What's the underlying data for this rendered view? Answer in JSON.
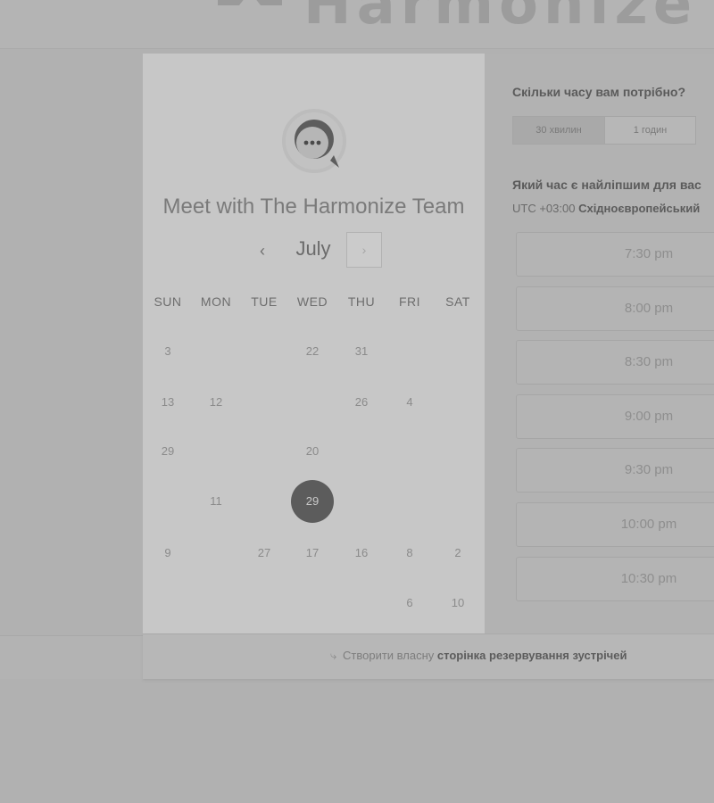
{
  "header": {
    "brand": "Harmonize"
  },
  "calendar": {
    "title": "Meet with The Harmonize Team",
    "month": "July",
    "prev_label": "‹",
    "next_label": "›",
    "weekdays": [
      "SUN",
      "MON",
      "TUE",
      "WED",
      "THU",
      "FRI",
      "SAT"
    ],
    "days": [
      {
        "label": "3",
        "col": 0,
        "row": 0
      },
      {
        "label": "22",
        "col": 3,
        "row": 0
      },
      {
        "label": "31",
        "col": 4,
        "row": 0
      },
      {
        "label": "13",
        "col": 0,
        "row": 1
      },
      {
        "label": "12",
        "col": 1,
        "row": 1
      },
      {
        "label": "26",
        "col": 4,
        "row": 1
      },
      {
        "label": "4",
        "col": 5,
        "row": 1
      },
      {
        "label": "29",
        "col": 0,
        "row": 2
      },
      {
        "label": "20",
        "col": 3,
        "row": 2
      },
      {
        "label": "11",
        "col": 1,
        "row": 3
      },
      {
        "label": "29",
        "col": 3,
        "row": 3,
        "selected": true
      },
      {
        "label": "9",
        "col": 0,
        "row": 4
      },
      {
        "label": "27",
        "col": 2,
        "row": 4
      },
      {
        "label": "17",
        "col": 3,
        "row": 4
      },
      {
        "label": "16",
        "col": 4,
        "row": 4
      },
      {
        "label": "8",
        "col": 5,
        "row": 4
      },
      {
        "label": "2",
        "col": 6,
        "row": 4
      },
      {
        "label": "6",
        "col": 5,
        "row": 5
      },
      {
        "label": "10",
        "col": 6,
        "row": 5
      }
    ]
  },
  "booking": {
    "duration_question": "Скільки часу вам потрібно?",
    "durations": [
      "30 хвилин",
      "1 годин"
    ],
    "time_question": "Який час є найліпшим для вас",
    "tz_offset": "UTC +03:00",
    "tz_name": "Східноєвропейський",
    "slots": [
      "7:30 pm",
      "8:00 pm",
      "8:30 pm",
      "9:00 pm",
      "9:30 pm",
      "10:00 pm",
      "10:30 pm"
    ]
  },
  "footer": {
    "prefix": "Створити власну",
    "link": "сторінка резервування зустрічей"
  },
  "colors": {
    "selected_day": "#5c5c5c",
    "card_left": "#c7c7c7",
    "page_bg": "#b1b1b1"
  }
}
